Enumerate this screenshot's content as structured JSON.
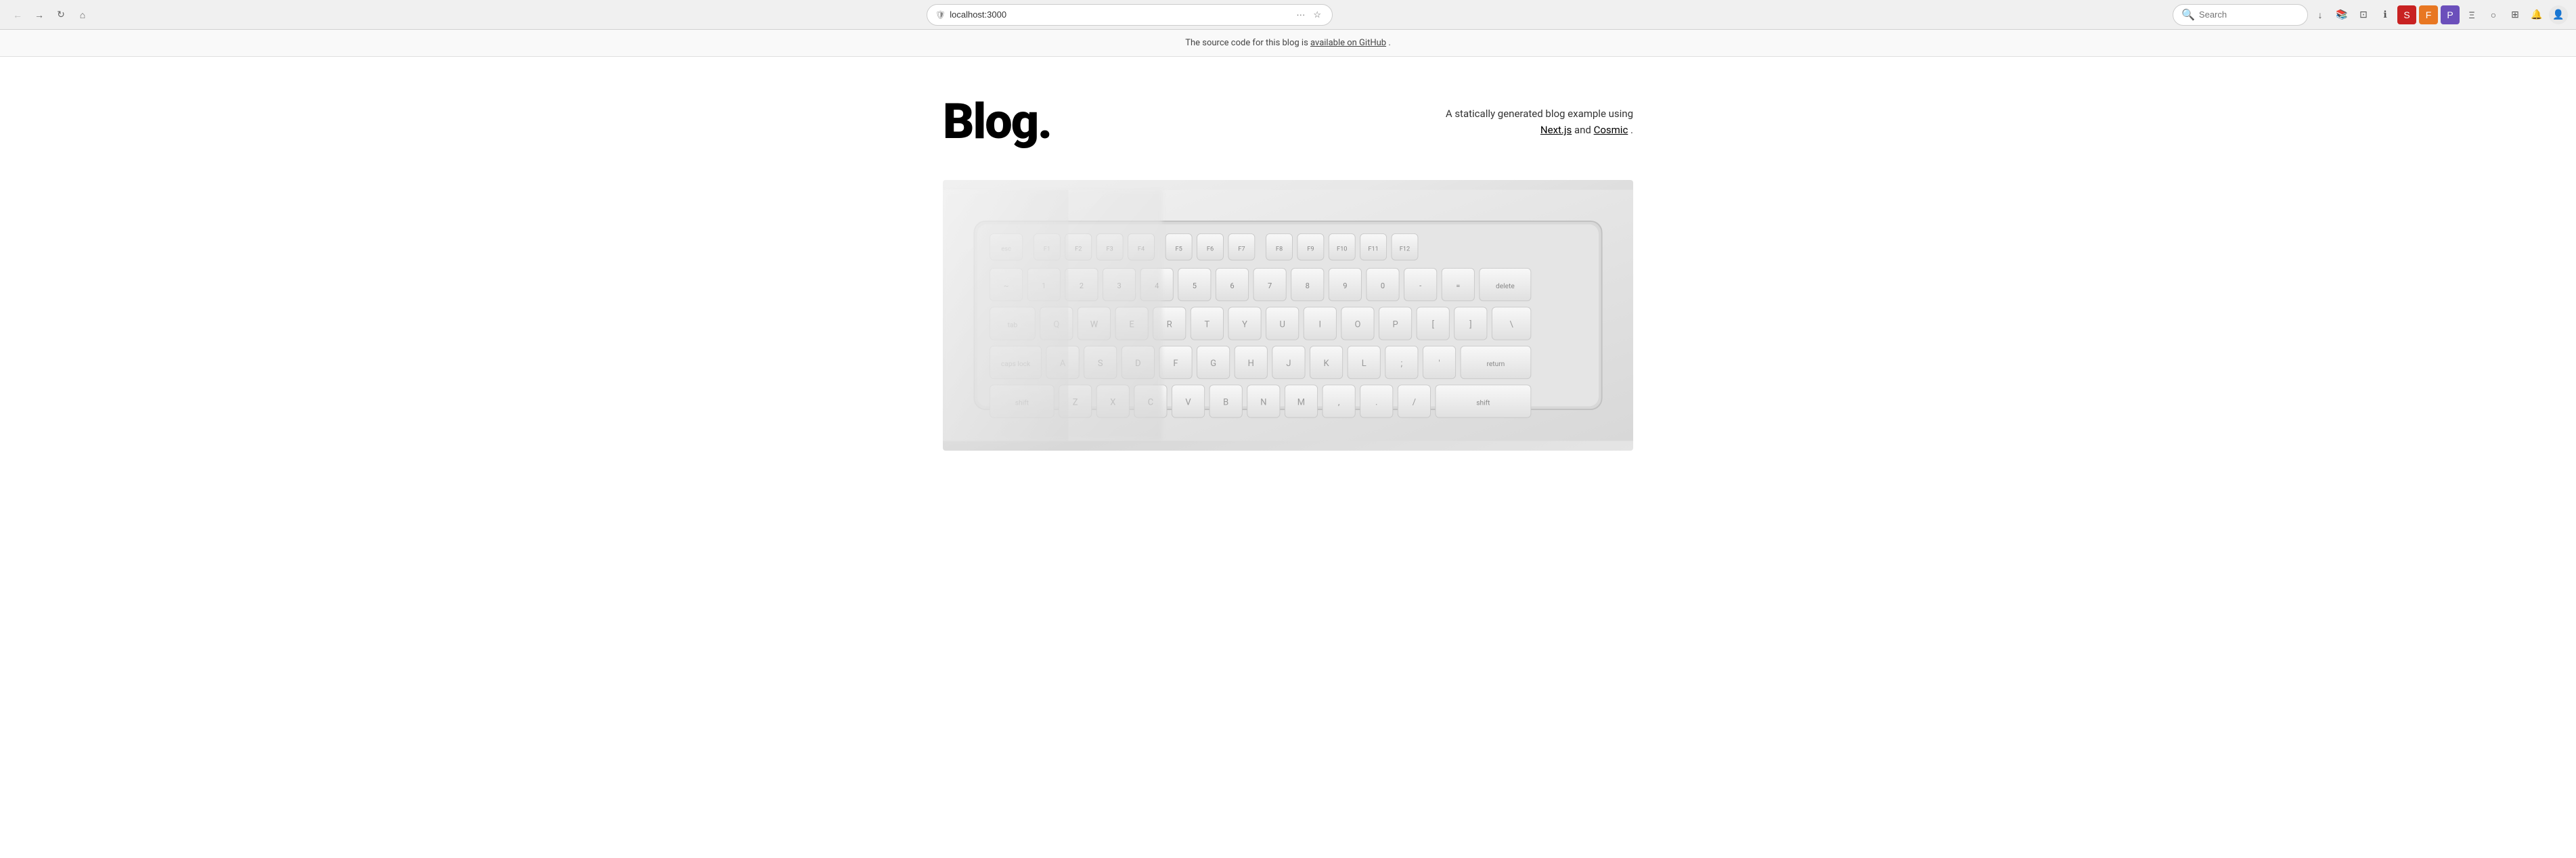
{
  "browser": {
    "url": "localhost:3000",
    "search_placeholder": "Search",
    "nav": {
      "back_label": "←",
      "forward_label": "→",
      "reload_label": "↻",
      "home_label": "⌂",
      "more_label": "···",
      "bookmark_label": "☆",
      "download_label": "↓",
      "library_label": "📚",
      "sync_label": "⊡",
      "info_label": "ℹ",
      "addon1_label": "S",
      "addon2_label": "F",
      "addon3_label": "P",
      "reader_label": "Ξ",
      "pocket_label": "○",
      "grid_label": "⊞",
      "notif_label": "🔔",
      "profile_label": "👤"
    }
  },
  "notification_banner": {
    "text_before": "The source code for this blog is ",
    "link_text": "available on GitHub",
    "text_after": "."
  },
  "page": {
    "title": "Blog.",
    "description_before": "A statically generated blog example using ",
    "link1_text": "Next.js",
    "description_middle": " and ",
    "link2_text": "Cosmic",
    "description_after": "."
  }
}
